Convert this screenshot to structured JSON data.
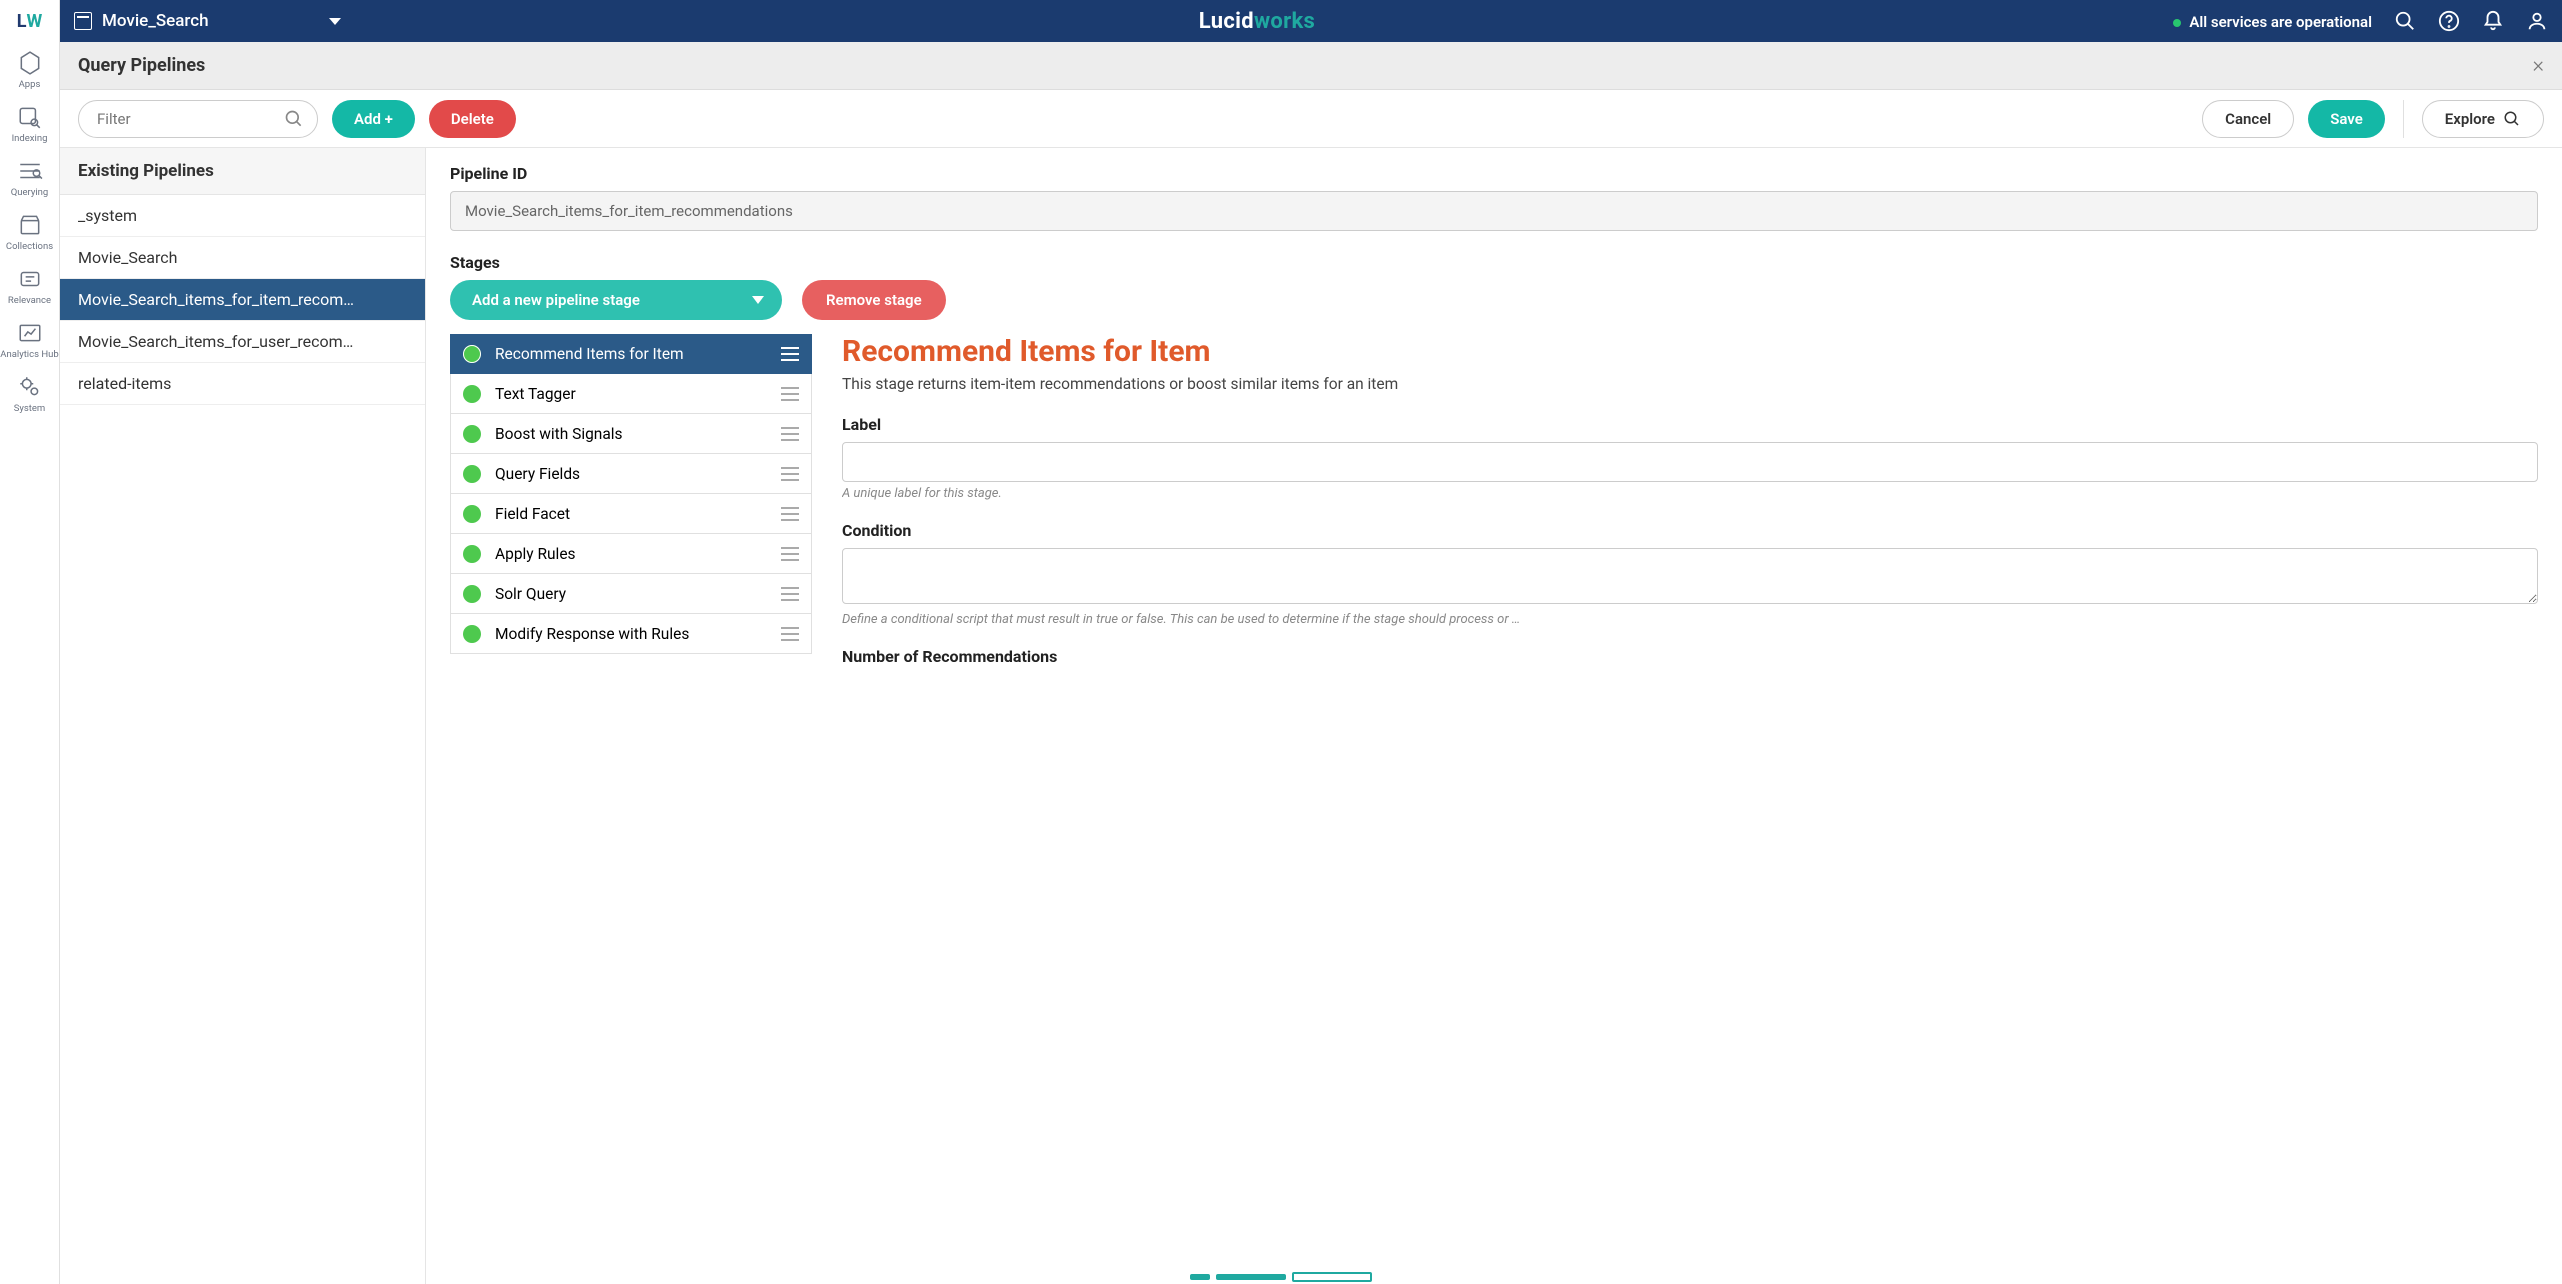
{
  "logo": {
    "part1": "L",
    "part2": "W"
  },
  "brand": {
    "part1": "Lucid",
    "part2": "works"
  },
  "topbar": {
    "app_name": "Movie_Search",
    "status_text": "All services are operational"
  },
  "nav_items": [
    {
      "label": "Apps"
    },
    {
      "label": "Indexing"
    },
    {
      "label": "Querying"
    },
    {
      "label": "Collections"
    },
    {
      "label": "Relevance"
    },
    {
      "label": "Analytics Hub"
    },
    {
      "label": "System"
    }
  ],
  "page": {
    "title": "Query Pipelines",
    "close": "×"
  },
  "toolbar": {
    "filter_placeholder": "Filter",
    "add_label": "Add +",
    "delete_label": "Delete",
    "cancel_label": "Cancel",
    "save_label": "Save",
    "explore_label": "Explore"
  },
  "pipelines": {
    "header": "Existing Pipelines",
    "items": [
      {
        "name": "_system"
      },
      {
        "name": "Movie_Search"
      },
      {
        "name": "Movie_Search_items_for_item_recom…",
        "active": true
      },
      {
        "name": "Movie_Search_items_for_user_recom…"
      },
      {
        "name": "related-items"
      }
    ]
  },
  "editor": {
    "pipeline_id_label": "Pipeline ID",
    "pipeline_id_value": "Movie_Search_items_for_item_recommendations",
    "stages_label": "Stages",
    "add_stage_label": "Add a new pipeline stage",
    "remove_stage_label": "Remove stage",
    "stages": [
      {
        "name": "Recommend Items for Item",
        "active": true
      },
      {
        "name": "Text Tagger"
      },
      {
        "name": "Boost with Signals"
      },
      {
        "name": "Query Fields"
      },
      {
        "name": "Field Facet"
      },
      {
        "name": "Apply Rules"
      },
      {
        "name": "Solr Query"
      },
      {
        "name": "Modify Response with Rules"
      }
    ]
  },
  "detail": {
    "title": "Recommend Items for Item",
    "description": "This stage returns item-item recommendations or boost similar items for an item",
    "label_label": "Label",
    "label_help": "A unique label for this stage.",
    "condition_label": "Condition",
    "condition_help": "Define a conditional script that must result in true or false. This can be used to determine if the stage should process or …",
    "num_rec_label": "Number of Recommendations"
  }
}
